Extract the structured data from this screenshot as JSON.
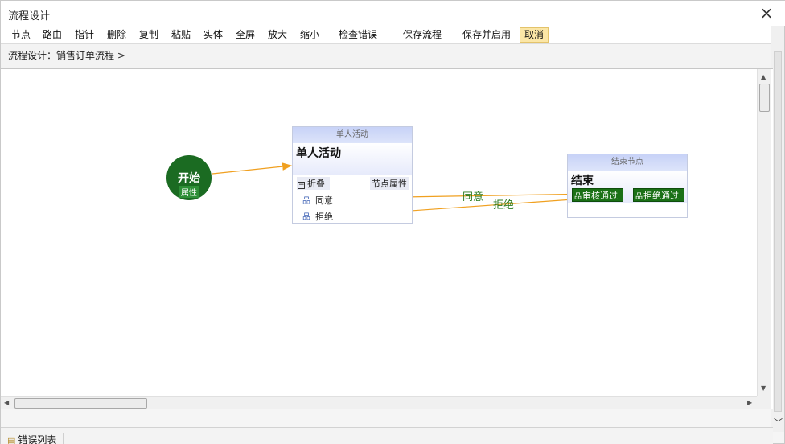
{
  "window": {
    "title": "流程设计",
    "close_icon": "×"
  },
  "toolbar": {
    "items": [
      "节点",
      "路由",
      "指针",
      "删除",
      "复制",
      "粘贴",
      "实体",
      "全屏",
      "放大",
      "缩小",
      "检查错误",
      "保存流程",
      "保存并启用",
      "取消"
    ],
    "active_item": "取消",
    "active_color": "#fbe6a6"
  },
  "breadcrumb": "流程设计：销售订单流程 >",
  "diagram": {
    "start": {
      "label": "开始",
      "props": "属性"
    },
    "activity": {
      "header": "单人活动",
      "title": "单人活动",
      "collapse": "折叠",
      "node_props": "节点属性",
      "branches": [
        "同意",
        "拒绝"
      ]
    },
    "end": {
      "header": "结束节点",
      "title": "结束",
      "buttons": [
        "审核通过",
        "拒绝通过"
      ]
    },
    "edge_labels": [
      "同意",
      "拒绝"
    ],
    "colors": {
      "start_fill": "#1b6b22",
      "edge": "#f0a020",
      "end_button": "#1a7016",
      "edge_label": "#2a7a1e"
    }
  },
  "bottom": {
    "error_tab": "错误列表",
    "icon": "clipboard-icon"
  }
}
